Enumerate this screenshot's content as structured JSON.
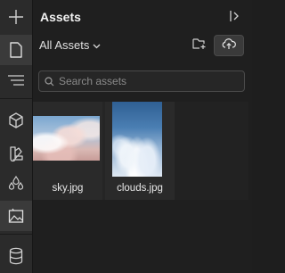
{
  "panel": {
    "title": "Assets",
    "filter_label": "All Assets",
    "search_placeholder": "Search assets"
  },
  "rail": {
    "items": [
      {
        "icon": "plus-icon"
      },
      {
        "icon": "page-icon",
        "active": true
      },
      {
        "icon": "layers-icon"
      },
      {
        "icon": "cube-icon"
      },
      {
        "icon": "swatch-book-icon"
      },
      {
        "icon": "droplets-icon"
      },
      {
        "icon": "image-icon",
        "active": true
      },
      {
        "icon": "database-icon"
      }
    ]
  },
  "assets": [
    {
      "name": "sky.jpg",
      "thumb": "pink-clouds-sky"
    },
    {
      "name": "clouds.jpg",
      "thumb": "blue-sky-clouds"
    }
  ],
  "colors": {
    "background": "#1e1e1e",
    "rail": "#2b2b2b",
    "active": "#3a3a3a",
    "text": "#e6e6e6"
  }
}
